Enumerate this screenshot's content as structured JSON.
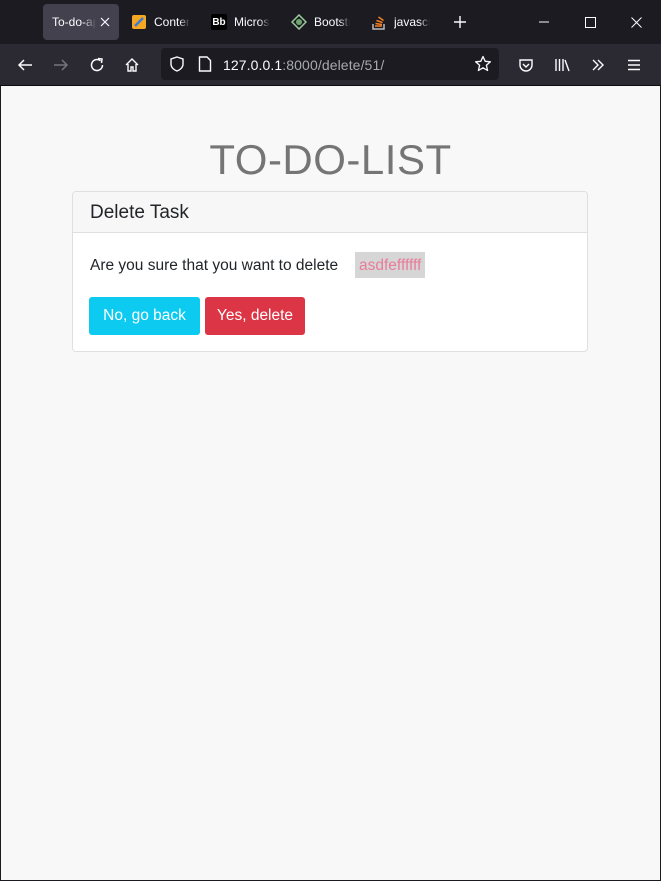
{
  "browser": {
    "tabs": [
      {
        "label": "To-do-app",
        "active": true,
        "favicon": "page-icon"
      },
      {
        "label": "Content",
        "active": false,
        "favicon": "notebook-icon"
      },
      {
        "label": "Microsoft",
        "active": false,
        "favicon": "bb-logo-icon"
      },
      {
        "label": "Bootstrap",
        "active": false,
        "favicon": "globe-icon"
      },
      {
        "label": "javascript",
        "active": false,
        "favicon": "stackoverflow-icon"
      }
    ],
    "favicon_bb_text": "Bb",
    "url_host": "127.0.0.1",
    "url_rest": ":8000/delete/51/"
  },
  "page": {
    "title": "TO-DO-LIST",
    "card_header": "Delete Task",
    "question": "Are you sure that you want to delete",
    "task_name": "asdfeffffff",
    "back_button": "No, go back",
    "delete_button": "Yes, delete"
  },
  "colors": {
    "info": "#0dcaf0",
    "danger": "#dc3545",
    "task_text": "#e87c9a"
  }
}
